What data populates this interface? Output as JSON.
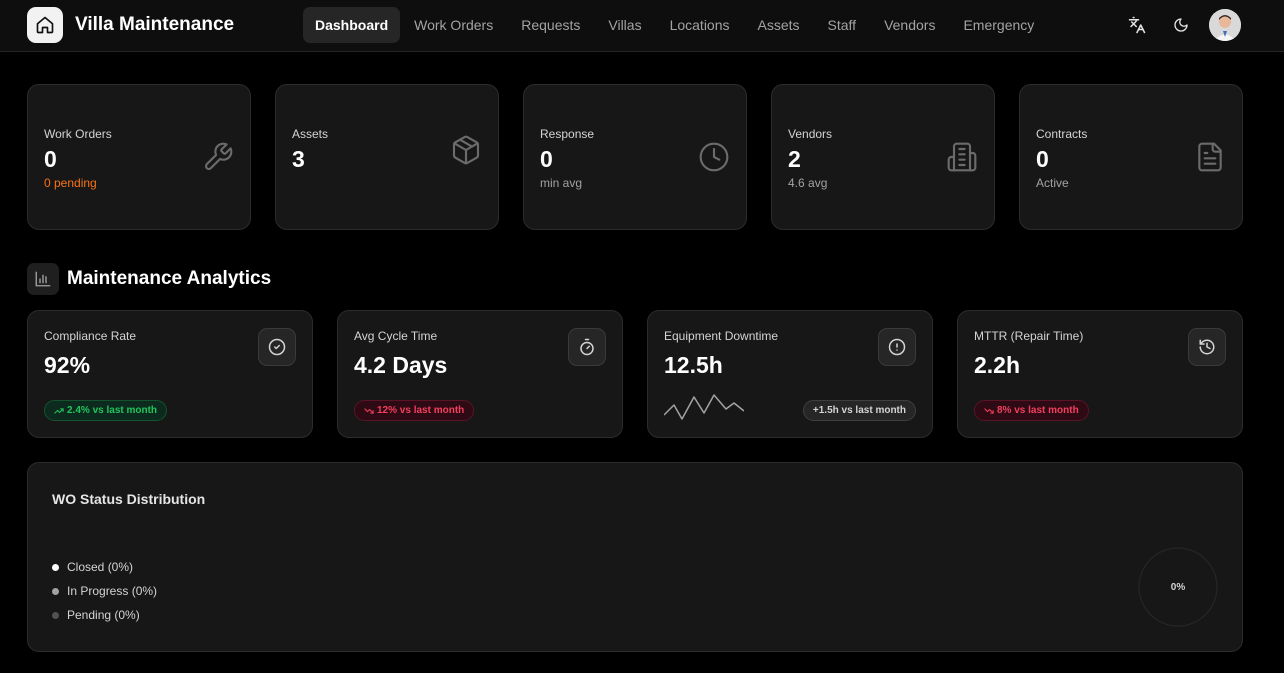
{
  "app": {
    "title": "Villa Maintenance"
  },
  "nav": {
    "items": [
      {
        "label": "Dashboard",
        "active": true
      },
      {
        "label": "Work Orders"
      },
      {
        "label": "Requests"
      },
      {
        "label": "Villas"
      },
      {
        "label": "Locations"
      },
      {
        "label": "Assets"
      },
      {
        "label": "Staff"
      },
      {
        "label": "Vendors"
      },
      {
        "label": "Emergency"
      }
    ]
  },
  "header_icons": [
    "translate-icon",
    "moon-icon",
    "avatar"
  ],
  "stats": [
    {
      "label": "Work Orders",
      "value": "0",
      "sub": "0 pending",
      "icon": "wrench-icon"
    },
    {
      "label": "Assets",
      "value": "3",
      "sub": "",
      "icon": "box-icon"
    },
    {
      "label": "Response",
      "value": "0",
      "sub": "min avg",
      "icon": "clock-icon"
    },
    {
      "label": "Vendors",
      "value": "2",
      "sub": "4.6 avg",
      "icon": "building-icon"
    },
    {
      "label": "Contracts",
      "value": "0",
      "sub": "Active",
      "icon": "document-icon"
    }
  ],
  "analytics": {
    "title": "Maintenance Analytics",
    "metrics": [
      {
        "label": "Compliance Rate",
        "value": "92%",
        "badge": "2.4% vs last month",
        "trend": "up",
        "icon": "check-circle-icon"
      },
      {
        "label": "Avg Cycle Time",
        "value": "4.2 Days",
        "badge": "12% vs last month",
        "trend": "down",
        "icon": "stopwatch-icon"
      },
      {
        "label": "Equipment Downtime",
        "value": "12.5h",
        "badge": "+1.5h vs last month",
        "trend": "neutral",
        "icon": "alert-circle-icon"
      },
      {
        "label": "MTTR (Repair Time)",
        "value": "2.2h",
        "badge": "8% vs last month",
        "trend": "down",
        "icon": "history-icon"
      }
    ]
  },
  "wo_status": {
    "title": "WO Status Distribution",
    "legend": [
      {
        "label": "Closed (0%)",
        "color": "#ffffff"
      },
      {
        "label": "In Progress (0%)",
        "color": "#a3a3a3"
      },
      {
        "label": "Pending (0%)",
        "color": "#525252"
      }
    ],
    "center_label": "0%"
  },
  "colors": {
    "accent_orange": "#f97316",
    "positive": "#22c55e",
    "negative": "#f43f5e"
  }
}
